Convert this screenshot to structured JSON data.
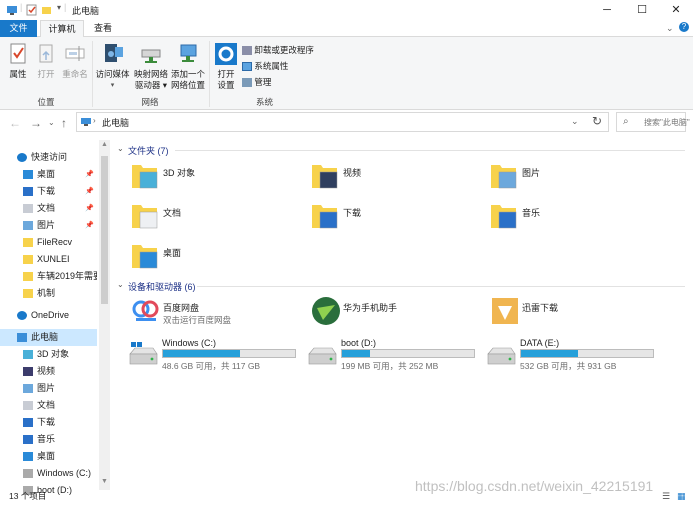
{
  "window": {
    "title": "此电脑"
  },
  "ribbon": {
    "tabs": [
      "文件",
      "计算机",
      "查看"
    ],
    "groups": [
      {
        "label": "位置",
        "items": [
          {
            "label": "属性"
          },
          {
            "label": "打开"
          },
          {
            "label": "重命名"
          }
        ]
      },
      {
        "label": "网络",
        "items": [
          {
            "label": "访问媒体",
            "line2": ""
          },
          {
            "label": "映射网络",
            "line2": "驱动器"
          },
          {
            "label": "添加一个",
            "line2": "网络位置"
          }
        ]
      },
      {
        "label": "系统",
        "items": [
          {
            "label": "打开",
            "line2": "设置"
          },
          {
            "label": "卸载或更改程序"
          },
          {
            "label": "系统属性"
          },
          {
            "label": "管理"
          }
        ]
      }
    ]
  },
  "address": {
    "path": "此电脑",
    "search_placeholder": "搜索\"此电脑\""
  },
  "sidebar": {
    "items": [
      {
        "label": "快速访问",
        "icon": "star-icon"
      },
      {
        "label": "桌面",
        "icon": "desktop-icon",
        "pinned": true
      },
      {
        "label": "下载",
        "icon": "download-icon",
        "pinned": true
      },
      {
        "label": "文档",
        "icon": "document-icon",
        "pinned": true
      },
      {
        "label": "图片",
        "icon": "picture-icon",
        "pinned": true
      },
      {
        "label": "FileRecv",
        "icon": "folder-icon"
      },
      {
        "label": "XUNLEI",
        "icon": "folder-icon"
      },
      {
        "label": "车辆2019年需要",
        "icon": "folder-icon"
      },
      {
        "label": "机制",
        "icon": "folder-icon"
      },
      {
        "label": "OneDrive",
        "icon": "cloud-icon"
      },
      {
        "label": "此电脑",
        "icon": "computer-icon"
      },
      {
        "label": "3D 对象",
        "icon": "cube-icon"
      },
      {
        "label": "视频",
        "icon": "video-icon"
      },
      {
        "label": "图片",
        "icon": "picture-icon"
      },
      {
        "label": "文档",
        "icon": "document-icon"
      },
      {
        "label": "下载",
        "icon": "download-icon"
      },
      {
        "label": "音乐",
        "icon": "music-icon"
      },
      {
        "label": "桌面",
        "icon": "desktop-icon"
      },
      {
        "label": "Windows (C:)",
        "icon": "drive-icon"
      },
      {
        "label": "boot (D:)",
        "icon": "drive-icon"
      }
    ]
  },
  "content": {
    "folders_header": "文件夹 (7)",
    "folders": [
      {
        "label": "3D 对象",
        "icon": "cube-folder-icon"
      },
      {
        "label": "视频",
        "icon": "video-folder-icon"
      },
      {
        "label": "图片",
        "icon": "picture-folder-icon"
      },
      {
        "label": "文档",
        "icon": "document-folder-icon"
      },
      {
        "label": "下载",
        "icon": "download-folder-icon"
      },
      {
        "label": "音乐",
        "icon": "music-folder-icon"
      },
      {
        "label": "桌面",
        "icon": "desktop-folder-icon"
      }
    ],
    "devices_header": "设备和驱动器 (6)",
    "devices": [
      {
        "label": "百度网盘",
        "sub": "双击运行百度网盘",
        "icon": "baidu-icon"
      },
      {
        "label": "华为手机助手",
        "sub": "",
        "icon": "huawei-icon"
      },
      {
        "label": "迅雷下载",
        "sub": "",
        "icon": "xunlei-icon"
      }
    ],
    "drives": [
      {
        "label": "Windows (C:)",
        "detail": "48.6 GB 可用，共 117 GB",
        "used_fraction": 0.585
      },
      {
        "label": "boot (D:)",
        "detail": "199 MB 可用，共 252 MB",
        "used_fraction": 0.21
      },
      {
        "label": "DATA (E:)",
        "detail": "532 GB 可用，共 931 GB",
        "used_fraction": 0.43
      }
    ]
  },
  "status": {
    "count": "13 个项目"
  },
  "watermark": "https://blog.csdn.net/weixin_42215191",
  "colors": {
    "accent": "#1979ca",
    "bar_fill": "#26a0da",
    "folder": "#f7d24b"
  }
}
